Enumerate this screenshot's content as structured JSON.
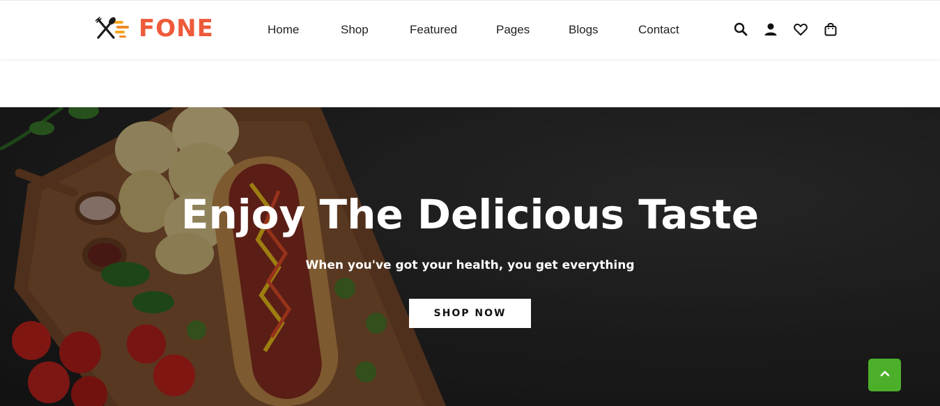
{
  "header": {
    "logo_text": "FONE",
    "logo_icon": "fork-knife-icon",
    "brand_color": "#ee5a3a",
    "nav": [
      {
        "label": "Home"
      },
      {
        "label": "Shop"
      },
      {
        "label": "Featured"
      },
      {
        "label": "Pages"
      },
      {
        "label": "Blogs"
      },
      {
        "label": "Contact"
      }
    ],
    "actions": [
      {
        "icon": "search-icon"
      },
      {
        "icon": "user-icon"
      },
      {
        "icon": "heart-icon"
      },
      {
        "icon": "shopping-bag-icon"
      }
    ]
  },
  "hero": {
    "title": "Enjoy The Delicious Taste",
    "subtitle": "When you've got your health, you get everything",
    "button_label": "SHOP NOW"
  },
  "scroll_top": {
    "icon": "chevron-up-icon",
    "color": "#4caf2a"
  }
}
